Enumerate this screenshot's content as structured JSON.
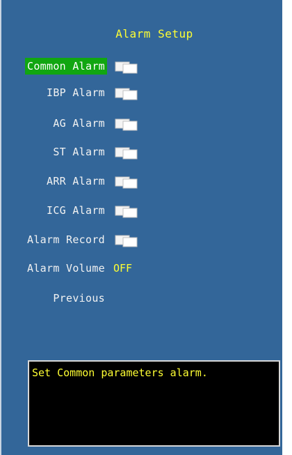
{
  "header": {
    "title": "Alarm Setup"
  },
  "menu": {
    "common_alarm": "Common Alarm",
    "ibp_alarm": "IBP Alarm",
    "ag_alarm": "AG Alarm",
    "st_alarm": "ST Alarm",
    "arr_alarm": "ARR Alarm",
    "icg_alarm": "ICG Alarm",
    "alarm_record": "Alarm Record",
    "alarm_volume": "Alarm Volume",
    "alarm_volume_value": "OFF",
    "previous": "Previous",
    "selected": "Common Alarm"
  },
  "help": {
    "text": "Set Common parameters alarm."
  },
  "icons": {
    "submenu": "submenu-pages-icon"
  },
  "colors": {
    "panel_bg": "#336699",
    "selected_bg": "#11A611",
    "highlight_text": "#FFFF33",
    "help_bg": "#000000"
  }
}
